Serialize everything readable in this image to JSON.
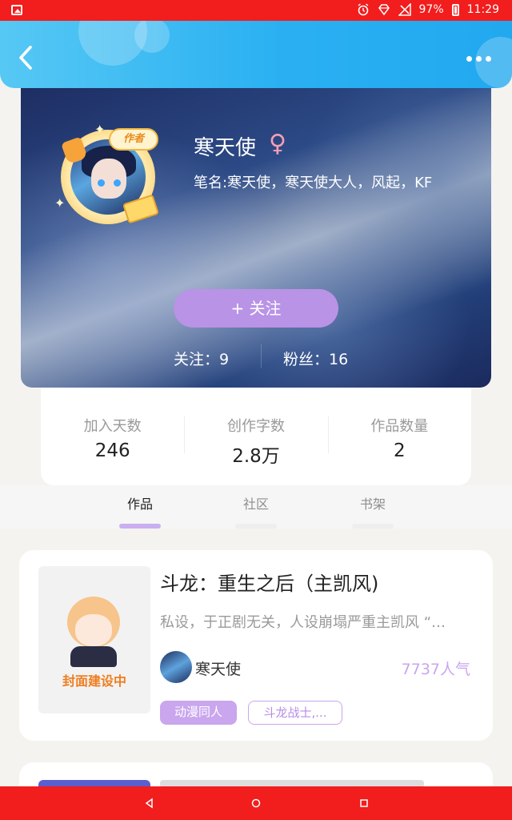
{
  "status_bar": {
    "battery": "97%",
    "time": "11:29",
    "icons": [
      "image-icon",
      "alarm-icon",
      "diamond-icon",
      "no-signal-icon",
      "battery-icon"
    ]
  },
  "header": {
    "back_icon": "chevron-left-icon",
    "more_icon": "more-horizontal-icon",
    "gradient": [
      "#56c8f4",
      "#21a8ef"
    ]
  },
  "profile": {
    "avatar_badge": "作者",
    "name": "寒天使",
    "gender_symbol": "♀",
    "pen_name": "笔名:寒天使，寒天使大人，风起，KF",
    "follow_button": "+  关注",
    "following": "关注：9",
    "fans": "粉丝：16"
  },
  "stats": [
    {
      "label": "加入天数",
      "value": "246"
    },
    {
      "label": "创作字数",
      "value": "2.8万"
    },
    {
      "label": "作品数量",
      "value": "2"
    }
  ],
  "tabs": [
    {
      "label": "作品",
      "active": true
    },
    {
      "label": "社区",
      "active": false
    },
    {
      "label": "书架",
      "active": false
    }
  ],
  "works": [
    {
      "cover_text": "封面建设中",
      "title": "斗龙：重生之后（主凯风)",
      "description": "私设，于正剧无关，人设崩塌严重主凯风 “…",
      "author": "寒天使",
      "popularity": "7737人气",
      "tags": [
        "动漫同人",
        "斗龙战士,..."
      ]
    }
  ],
  "colors": {
    "status_bar": "#f21d1d",
    "accent_purple": "#c9a6ee",
    "follow_button": "#b993e6",
    "cover_text": "#ef7d1e"
  }
}
